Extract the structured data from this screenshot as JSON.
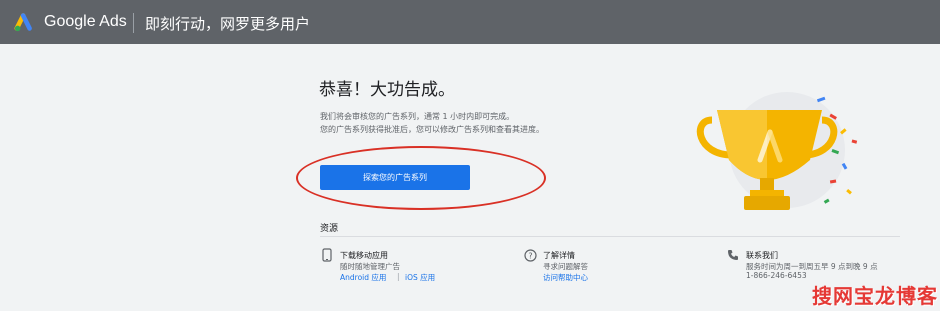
{
  "header": {
    "brand": "Google Ads",
    "tagline": "即刻行动，网罗更多用户"
  },
  "main": {
    "title": "恭喜！大功告成。",
    "description_line1": "我们将会审核您的广告系列，通常 1 小时内即可完成。",
    "description_line2": "您的广告系列获得批准后，您可以修改广告系列和查看其进度。",
    "cta_label": "探索您的广告系列"
  },
  "resources": {
    "title": "资源",
    "items": [
      {
        "icon": "mobile-app-icon",
        "title": "下载移动应用",
        "subtitle": "随时随地管理广告",
        "links": [
          "Android 应用",
          "iOS 应用"
        ],
        "separator": "|"
      },
      {
        "icon": "help-circle-icon",
        "title": "了解详情",
        "subtitle": "寻求问题解答",
        "links": [
          "访问帮助中心"
        ]
      },
      {
        "icon": "phone-icon",
        "title": "联系我们",
        "subtitle": "服务时间为周一到周五早 9 点到晚 9 点",
        "phone": "1-866-246-6453"
      }
    ]
  },
  "watermark": "搜网宝龙博客",
  "colors": {
    "header_bg": "#5f6368",
    "primary": "#1a73e8",
    "annotation": "#d93025",
    "trophy": "#f4b400"
  }
}
